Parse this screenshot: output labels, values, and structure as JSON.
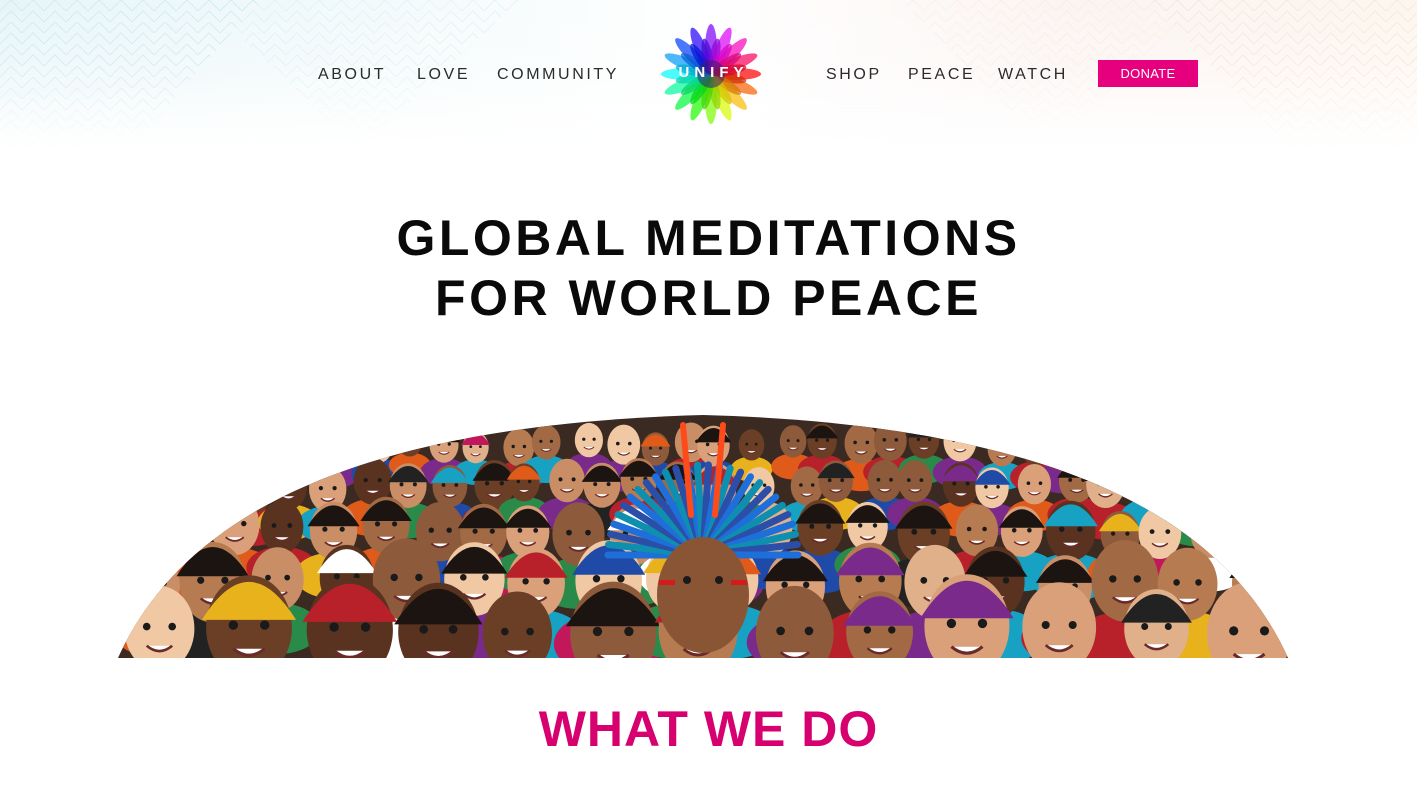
{
  "header": {
    "nav_left": [
      {
        "label": "ABOUT"
      },
      {
        "label": "LOVE"
      },
      {
        "label": "COMMUNITY"
      }
    ],
    "nav_right": [
      {
        "label": "SHOP"
      },
      {
        "label": "PEACE"
      },
      {
        "label": "WATCH"
      }
    ],
    "logo": {
      "text": "UNIFY",
      "icon": "rainbow-mandala-icon"
    },
    "donate_label": "DONATE",
    "colors": {
      "donate_bg": "#e6007e",
      "nav_text": "#2b2b2b"
    }
  },
  "hero": {
    "title_line1": "GLOBAL MEDITATIONS",
    "title_line2": "FOR WORLD PEACE",
    "image": "faces-collage-image"
  },
  "section": {
    "heading": "WHAT WE DO",
    "color": "#d6006f"
  }
}
